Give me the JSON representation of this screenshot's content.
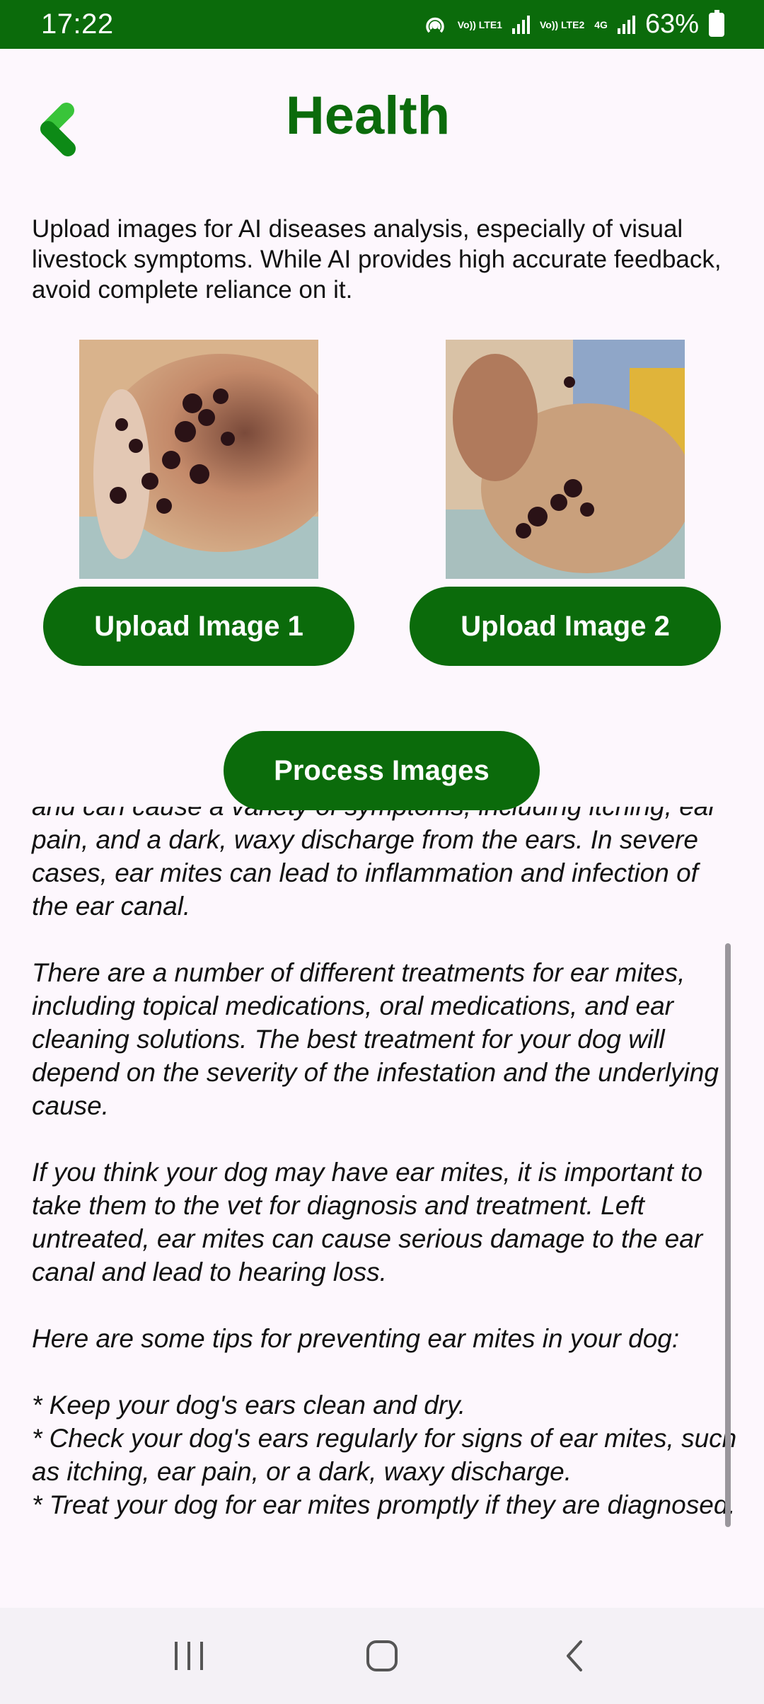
{
  "status_bar": {
    "time": "17:22",
    "battery": "63%",
    "net1": "Vo)) LTE1",
    "net2": "Vo)) LTE2",
    "net3": "4G"
  },
  "header": {
    "title": "Health"
  },
  "intro_text": "Upload images for AI diseases analysis, especially of visual livestock symptoms. While AI provides high accurate feedback, avoid complete reliance on it.",
  "buttons": {
    "upload1": "Upload Image 1",
    "upload2": "Upload Image 2",
    "process": "Process Images"
  },
  "results": {
    "text": "and can cause a variety of symptoms, including itching, ear pain, and a dark, waxy discharge from the ears. In severe cases, ear mites can lead to inflammation and infection of the ear canal.\n\nThere are a number of different treatments for ear mites, including topical medications, oral medications, and ear cleaning solutions. The best treatment for your dog will depend on the severity of the infestation and the underlying cause.\n\nIf you think your dog may have ear mites, it is important to take them to the vet for diagnosis and treatment. Left untreated, ear mites can cause serious damage to the ear canal and lead to hearing loss.\n\nHere are some tips for preventing ear mites in your dog:\n\n* Keep your dog's ears clean and dry.\n* Check your dog's ears regularly for signs of ear mites, such as itching, ear pain, or a dark, waxy discharge.\n* Treat your dog for ear mites promptly if they are diagnosed."
  },
  "colors": {
    "primary": "#0b6b0b",
    "background": "#fdf7fd"
  }
}
